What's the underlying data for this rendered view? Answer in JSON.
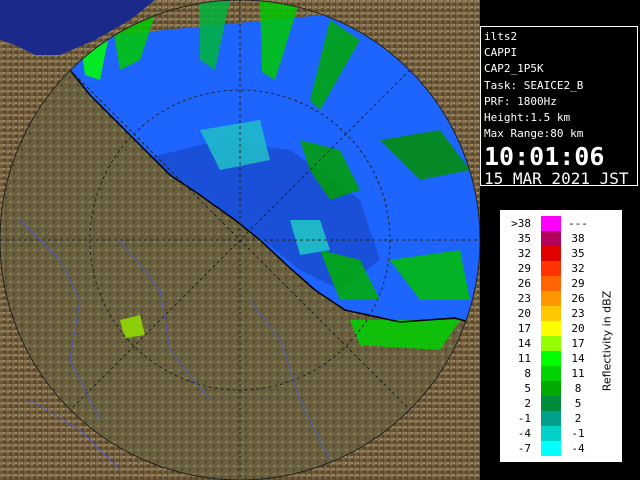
{
  "info_panel": {
    "station": "ilts2",
    "product": "CAPPI",
    "product_code": "CAP2_1P5K",
    "task": "Task: SEAICE2_B",
    "prf": "PRF: 1800Hz",
    "height": "Height:1.5 km",
    "max_range": "Max Range:80 km",
    "time": "10:01:06",
    "date": "15 MAR 2021 JST"
  },
  "legend": {
    "title": "Reflectivity in dBZ",
    "rows": [
      {
        "lo": ">38",
        "hi": "---",
        "color": "#ff00ff"
      },
      {
        "lo": "35",
        "hi": "38",
        "color": "#b2005a"
      },
      {
        "lo": "32",
        "hi": "35",
        "color": "#e00000"
      },
      {
        "lo": "29",
        "hi": "32",
        "color": "#ff3200"
      },
      {
        "lo": "26",
        "hi": "29",
        "color": "#ff6400"
      },
      {
        "lo": "23",
        "hi": "26",
        "color": "#ff9600"
      },
      {
        "lo": "20",
        "hi": "23",
        "color": "#ffc800"
      },
      {
        "lo": "17",
        "hi": "20",
        "color": "#ffff00"
      },
      {
        "lo": "14",
        "hi": "17",
        "color": "#96ff00"
      },
      {
        "lo": "11",
        "hi": "14",
        "color": "#00ff00"
      },
      {
        "lo": "8",
        "hi": "11",
        "color": "#00d200"
      },
      {
        "lo": "5",
        "hi": "8",
        "color": "#00aa00"
      },
      {
        "lo": "2",
        "hi": "5",
        "color": "#008c3c"
      },
      {
        "lo": "-1",
        "hi": "2",
        "color": "#00a08c"
      },
      {
        "lo": "-4",
        "hi": "-1",
        "color": "#00d2c8"
      },
      {
        "lo": "-7",
        "hi": "-4",
        "color": "#00ffff"
      }
    ]
  },
  "map": {
    "sea_color": "#1e64ff",
    "land_color": "#7a6440",
    "range_ring_color": "#222222",
    "coast_color": "#000000"
  }
}
